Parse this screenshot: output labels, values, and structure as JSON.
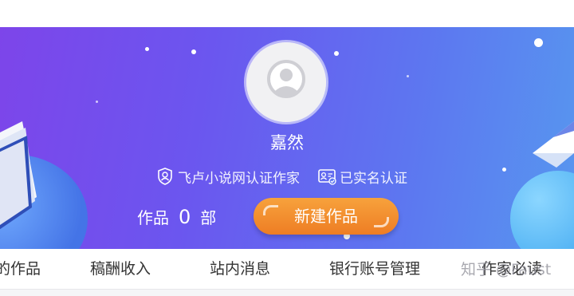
{
  "profile": {
    "username": "嘉然",
    "certifications": [
      {
        "label": "飞卢小说网认证作家",
        "icon": "shield-user-icon"
      },
      {
        "label": "已实名认证",
        "icon": "id-card-verified-icon"
      }
    ]
  },
  "works": {
    "prefix": "作品",
    "count": "0",
    "suffix": "部"
  },
  "actions": {
    "new_work_label": "新建作品"
  },
  "tabs": [
    {
      "label": "的作品"
    },
    {
      "label": "稿酬收入"
    },
    {
      "label": "站内消息"
    },
    {
      "label": "银行账号管理"
    },
    {
      "label": "作家必读"
    }
  ],
  "watermark": "知乎 @Faust",
  "colors": {
    "banner_start": "#7d45ea",
    "banner_end": "#5797ef",
    "button_orange": "#ee7d24",
    "tab_text": "#333333"
  }
}
